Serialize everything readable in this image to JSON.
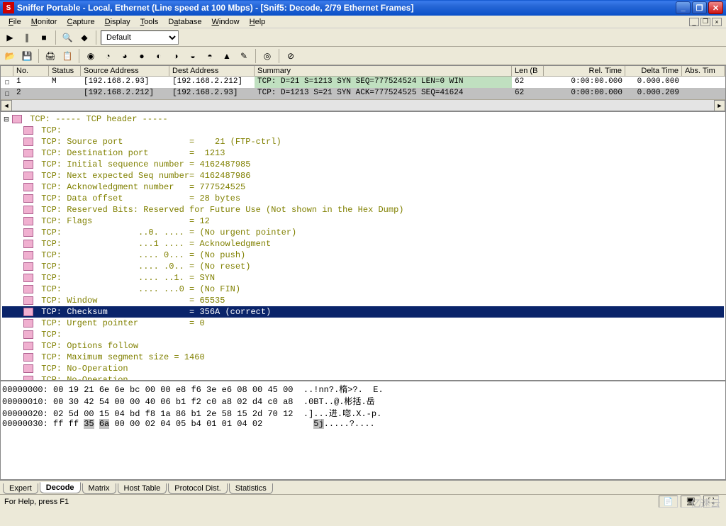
{
  "title": "Sniffer Portable - Local, Ethernet (Line speed at 100 Mbps) - [Snif5: Decode, 2/79 Ethernet Frames]",
  "menu": [
    "File",
    "Monitor",
    "Capture",
    "Display",
    "Tools",
    "Database",
    "Window",
    "Help"
  ],
  "toolbar2_dropdown": "Default",
  "packet_cols": [
    "",
    "No.",
    "Status",
    "Source Address",
    "Dest Address",
    "Summary",
    "Len (B",
    "Rel. Time",
    "Delta Time",
    "Abs. Tim"
  ],
  "packets": [
    {
      "no": "1",
      "status": "M",
      "src": "[192.168.2.93]",
      "dst": "[192.168.2.212]",
      "sum": "TCP: D=21 S=1213 SYN SEQ=777524524 LEN=0 WIN",
      "len": "62",
      "rel": "0:00:00.000",
      "delta": "0.000.000"
    },
    {
      "no": "2",
      "status": "",
      "src": "[192.168.2.212]",
      "dst": "[192.168.2.93]",
      "sum": "TCP: D=1213 S=21 SYN ACK=777524525 SEQ=41624",
      "len": "62",
      "rel": "0:00:00.000",
      "delta": "0.000.209"
    }
  ],
  "decode": [
    "TCP: ----- TCP header -----",
    "TCP:",
    "TCP: Source port             =    21 (FTP-ctrl)",
    "TCP: Destination port        =  1213",
    "TCP: Initial sequence number = 4162487985",
    "TCP: Next expected Seq number= 4162487986",
    "TCP: Acknowledgment number   = 777524525",
    "TCP: Data offset             = 28 bytes",
    "TCP: Reserved Bits: Reserved for Future Use (Not shown in the Hex Dump)",
    "TCP: Flags                   = 12",
    "TCP:               ..0. .... = (No urgent pointer)",
    "TCP:               ...1 .... = Acknowledgment",
    "TCP:               .... 0... = (No push)",
    "TCP:               .... .0.. = (No reset)",
    "TCP:               .... ..1. = SYN",
    "TCP:               .... ...0 = (No FIN)",
    "TCP: Window                  = 65535",
    "TCP: Checksum                = 356A (correct)",
    "TCP: Urgent pointer          = 0",
    "TCP:",
    "TCP: Options follow",
    "TCP: Maximum segment size = 1460",
    "TCP: No-Operation",
    "TCP: No-Operation"
  ],
  "decode_sel": 17,
  "hex": [
    {
      "a": "00000000:",
      "h": "00 19 21 6e 6e bc 00 00 e8 f6 3e e6 08 00 45 00",
      "t": "..!nn?.楕>?.  E."
    },
    {
      "a": "00000010:",
      "h": "00 30 42 54 00 00 40 06 b1 f2 c0 a8 02 d4 c0 a8",
      "t": ".0BT..@.彬括.岳"
    },
    {
      "a": "00000020:",
      "h": "02 5d 00 15 04 bd f8 1a 86 b1 2e 58 15 2d 70 12",
      "t": ".]...进.唿.X.-p."
    },
    {
      "a": "00000030:",
      "h": "ff ff 35 6a 00 00 02 04 05 b4 01 01 04 02      ",
      "t": "  5j.....?...."
    }
  ],
  "hex_hl": {
    "row": 3,
    "start": 2,
    "end": 3
  },
  "tabs": [
    "Expert",
    "Decode",
    "Matrix",
    "Host Table",
    "Protocol Dist.",
    "Statistics"
  ],
  "active_tab": 1,
  "status": "For Help, press F1",
  "watermark": "亿速云"
}
